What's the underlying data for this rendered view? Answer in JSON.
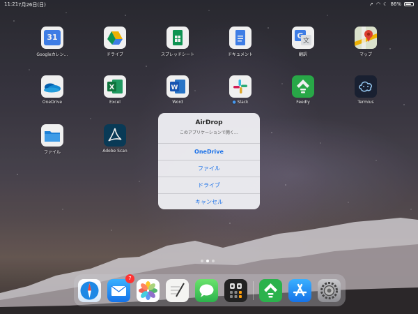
{
  "status_bar": {
    "time": "11:21",
    "date": "7月26日(日)",
    "battery": "86%"
  },
  "apps": [
    {
      "label": "Googleカレン…",
      "icon": "google-calendar-icon",
      "day": "31"
    },
    {
      "label": "ドライブ",
      "icon": "google-drive-icon"
    },
    {
      "label": "スプレッドシート",
      "icon": "google-sheets-icon"
    },
    {
      "label": "ドキュメント",
      "icon": "google-docs-icon"
    },
    {
      "label": "翻訳",
      "icon": "google-translate-icon"
    },
    {
      "label": "マップ",
      "icon": "google-maps-icon"
    },
    {
      "label": "OneDrive",
      "icon": "onedrive-icon"
    },
    {
      "label": "Excel",
      "icon": "excel-icon"
    },
    {
      "label": "Word",
      "icon": "word-icon"
    },
    {
      "label": "Slack",
      "icon": "slack-icon"
    },
    {
      "label": "Feedly",
      "icon": "feedly-icon"
    },
    {
      "label": "Termius",
      "icon": "termius-icon"
    },
    {
      "label": "ファイル",
      "icon": "files-icon"
    },
    {
      "label": "Adobe Scan",
      "icon": "adobe-scan-icon"
    }
  ],
  "sheet": {
    "title": "AirDrop",
    "subtitle": "このアプリケーションで開く…",
    "options": [
      "OneDrive",
      "ファイル",
      "ドライブ",
      "キャンセル"
    ]
  },
  "dock": {
    "mail_badge": "7",
    "icons": [
      "safari-icon",
      "mail-icon",
      "photos-icon",
      "notes-pen-icon",
      "messages-icon",
      "calculator-app-icon",
      "feedly-icon",
      "app-store-icon",
      "settings-icon"
    ]
  },
  "colors": {
    "link_blue": "#1d72e8",
    "badge_red": "#ff3333"
  }
}
